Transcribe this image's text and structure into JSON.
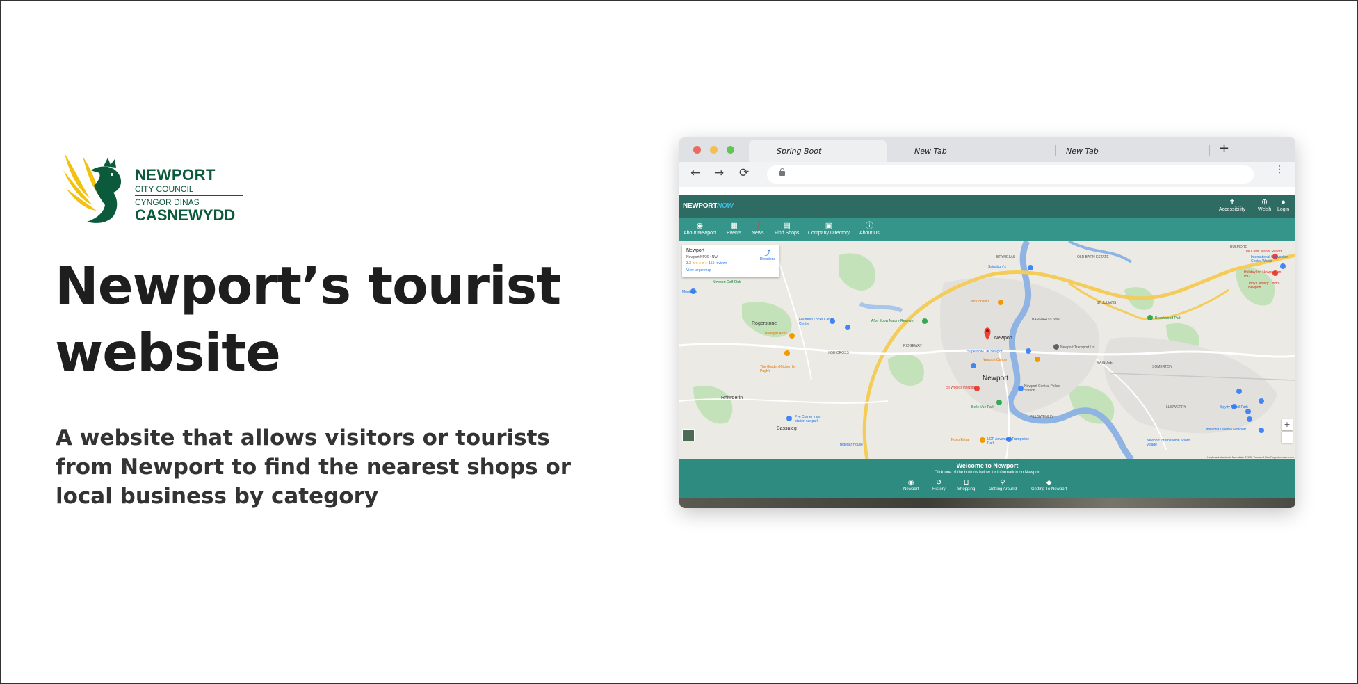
{
  "logo": {
    "name": "NEWPORT",
    "line2": "CITY COUNCIL",
    "line3": "CYNGOR DINAS",
    "line4": "CASNEWYDD",
    "colors": {
      "green": "#0b5a3c",
      "gold": "#f2c20f"
    }
  },
  "headline": "Newport’s tourist website",
  "description": "A website that allows visitors or tourists from Newport to find the nearest shops or local business by category",
  "browser": {
    "tabs": [
      "Spring Boot",
      "New Tab",
      "New Tab"
    ],
    "new_tab": "+",
    "back": "←",
    "forward": "→",
    "reload": "⟳",
    "menu": "⋮",
    "url": ""
  },
  "site": {
    "brand_a": "NEWPORT",
    "brand_b": "NOW",
    "header_actions": [
      {
        "label": "Accessibility",
        "icon": "accessibility-icon",
        "glyph": "✝"
      },
      {
        "label": "Welsh",
        "icon": "globe-icon",
        "glyph": "⊕"
      },
      {
        "label": "Login",
        "icon": "user-icon",
        "glyph": "●"
      }
    ],
    "nav": [
      {
        "label": "About Newport",
        "icon": "compass-icon",
        "glyph": "◉"
      },
      {
        "label": "Events",
        "icon": "calendar-icon",
        "glyph": "▦"
      },
      {
        "label": "News",
        "icon": "news-icon",
        "glyph": "❗"
      },
      {
        "label": "Find Shops",
        "icon": "store-icon",
        "glyph": "▤"
      },
      {
        "label": "Company Directory",
        "icon": "briefcase-icon",
        "glyph": "▣"
      },
      {
        "label": "About Us",
        "icon": "info-icon",
        "glyph": "ⓘ"
      }
    ],
    "map": {
      "card": {
        "name": "Newport",
        "address": "Newport NP20 4NW",
        "rating": "3.3",
        "stars": "★★★★☆",
        "reviews": "155 reviews",
        "link": "View larger map",
        "directions": "Directions"
      },
      "labels": {
        "newport": "Newport",
        "pin": "Newport",
        "rogerstone": "Rogerstone",
        "high_cross": "HIGH CROSS",
        "ridgeway": "RIDGEWAY",
        "rhiwderin": "Rhiwderin",
        "bassaleg": "Bassaleg",
        "bryngla": "BRYNGLAS",
        "barnardtown": "BARNARDTOWN",
        "old_barn": "OLD BARN ESTATE",
        "st_julians": "ST JULIANS",
        "somerton": "SOMERTON",
        "maindee": "MAINDEE",
        "bulmore": "BULMORE",
        "lliswerry": "LLISWERRY",
        "pillgwenlly": "PILLGWENLLY",
        "celtic_manor": "The Celtic Manor Resort",
        "intl_centre": "International Convention Centre Wales",
        "holiday_inn": "Holiday Inn Newport, an IHG",
        "toby": "Toby Carvery Coldra Newport",
        "beechwood": "Beechwood Park",
        "newport_transport": "Newport Transport Ltd",
        "superbowl": "Superbowl UK Newport",
        "newport_centre": "Newport Centre",
        "st_woolos": "St Woolos Hospital",
        "police": "Newport Central Police Station",
        "belle_vue": "Belle Vue Park",
        "tesco": "Tesco Extra",
        "lgp": "LGP Adventure Trampoline Park",
        "spytty": "Spytty Retail Park",
        "cineworld": "Cineworld Cinema Newport",
        "sports_village": "Newport International Sports Village",
        "mcdonalds": "McDonald's",
        "sainsburys": "Sainsbury's",
        "fourteen": "Fourteen Locks Canal Centre",
        "afon": "Afon Ebbw Nature Reserve",
        "tredegar": "Tredegar House",
        "pye_corner": "Pye Corner train station car park",
        "garden_kitchen": "The Garden Kitchen by Pugh's",
        "newport_golf": "Newport Golf Club",
        "tredegar_arms": "Tredegar Arms",
        "morrisons": "Morrisons"
      },
      "zoom_in": "+",
      "zoom_out": "−",
      "footer": "Keyboard shortcuts   Map data ©2022   Terms of Use   Report a map error"
    },
    "welcome": {
      "title": "Welcome to Newport",
      "subtitle": "Click one of the buttons below for information on Newport",
      "buttons": [
        {
          "label": "Newport",
          "icon": "compass-icon",
          "glyph": "◉"
        },
        {
          "label": "History",
          "icon": "history-icon",
          "glyph": "↺"
        },
        {
          "label": "Shopping",
          "icon": "basket-icon",
          "glyph": "⊔"
        },
        {
          "label": "Getting Around",
          "icon": "walk-icon",
          "glyph": "⚲"
        },
        {
          "label": "Getting To Newport",
          "icon": "directions-icon",
          "glyph": "◆"
        }
      ]
    }
  }
}
